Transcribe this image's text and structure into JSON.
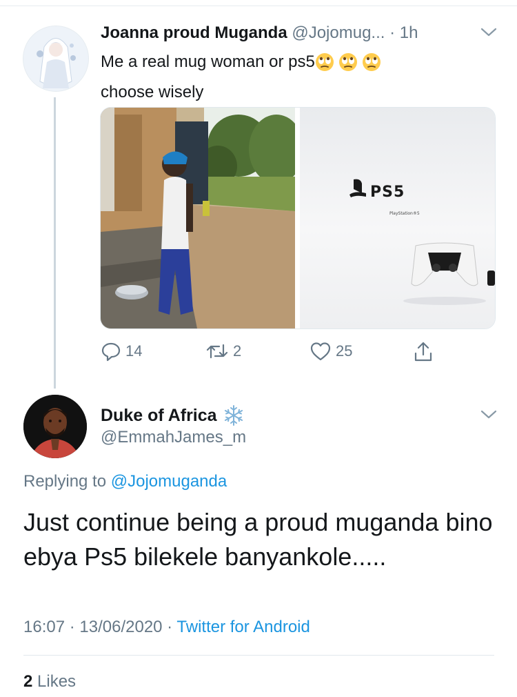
{
  "parent_tweet": {
    "display_name": "Joanna proud Muganda",
    "handle": "@Jojomug...",
    "separator": " · ",
    "time": "1h",
    "text_line1": "Me a real mug woman  or ps5",
    "emojis": [
      "face-with-rolling-eyes",
      "face-with-rolling-eyes",
      "face-with-rolling-eyes"
    ],
    "text_line2": "choose wisely",
    "media_right": {
      "logo_text": "PS5",
      "caption": "PlayStation®5"
    },
    "actions": {
      "replies": "14",
      "retweets": "2",
      "likes": "25"
    }
  },
  "tweet": {
    "display_name": "Duke of Africa",
    "handle": "@EmmahJames_m",
    "replying_prefix": "Replying to ",
    "replying_handle": "@Jojomuganda",
    "text": "Just continue being a proud muganda bino ebya Ps5 bilekele banyankole.....",
    "time": "16:07",
    "date": "13/06/2020",
    "dot": " · ",
    "source": "Twitter for Android",
    "likes_count": "2",
    "likes_label": " Likes"
  },
  "colors": {
    "link": "#1b95e0",
    "secondary": "#657786",
    "primary": "#14171a",
    "divider": "#e1e8ed"
  }
}
